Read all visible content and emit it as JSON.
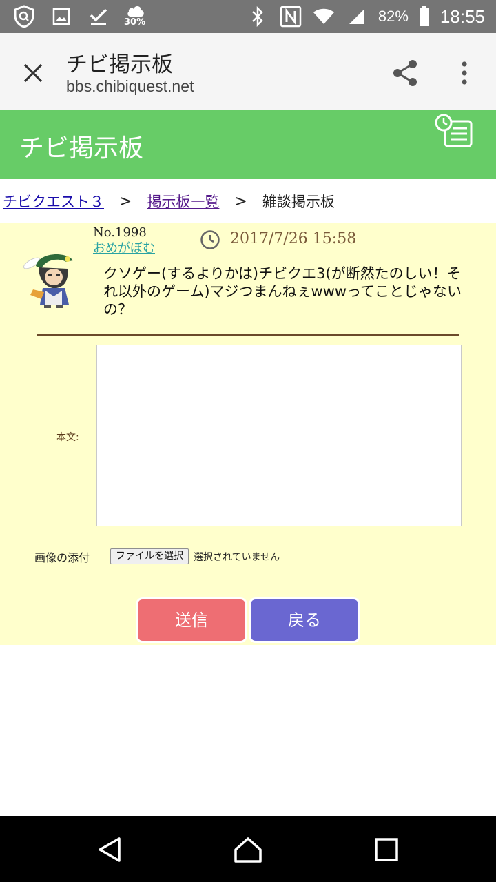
{
  "status_bar": {
    "weather_percent": "30%",
    "battery": "82%",
    "time": "18:55"
  },
  "browser": {
    "title": "チビ掲示板",
    "url": "bbs.chibiquest.net"
  },
  "site": {
    "title": "チビ掲示板",
    "header_color": "#67cc67"
  },
  "breadcrumb": {
    "items": [
      "チビクエスト３",
      "掲示板一覧",
      "雑談掲示板"
    ],
    "separator": ">"
  },
  "post": {
    "number": "No.1998",
    "author": "おめがぼむ",
    "date": "2017/7/26 15:58",
    "body": "クソゲー(するよりかは)チビクエ3(が断然たのしい！それ以外のゲーム)マジつまんねぇwwwってことじゃないの？"
  },
  "reply_form": {
    "body_label": "本文:",
    "body_value": "",
    "attach_label": "画像の添付",
    "file_button": "ファイルを選択",
    "file_status": "選択されていません",
    "send_label": "送信",
    "back_label": "戻る",
    "send_color": "#ee6e73",
    "back_color": "#6a67d1"
  },
  "icons": {
    "close": "close-icon",
    "share": "share-icon",
    "menu": "more-vert-icon",
    "history": "history-list-icon",
    "clock": "clock-icon",
    "nav_back": "back-triangle-icon",
    "nav_home": "home-icon",
    "nav_recents": "recents-square-icon"
  }
}
